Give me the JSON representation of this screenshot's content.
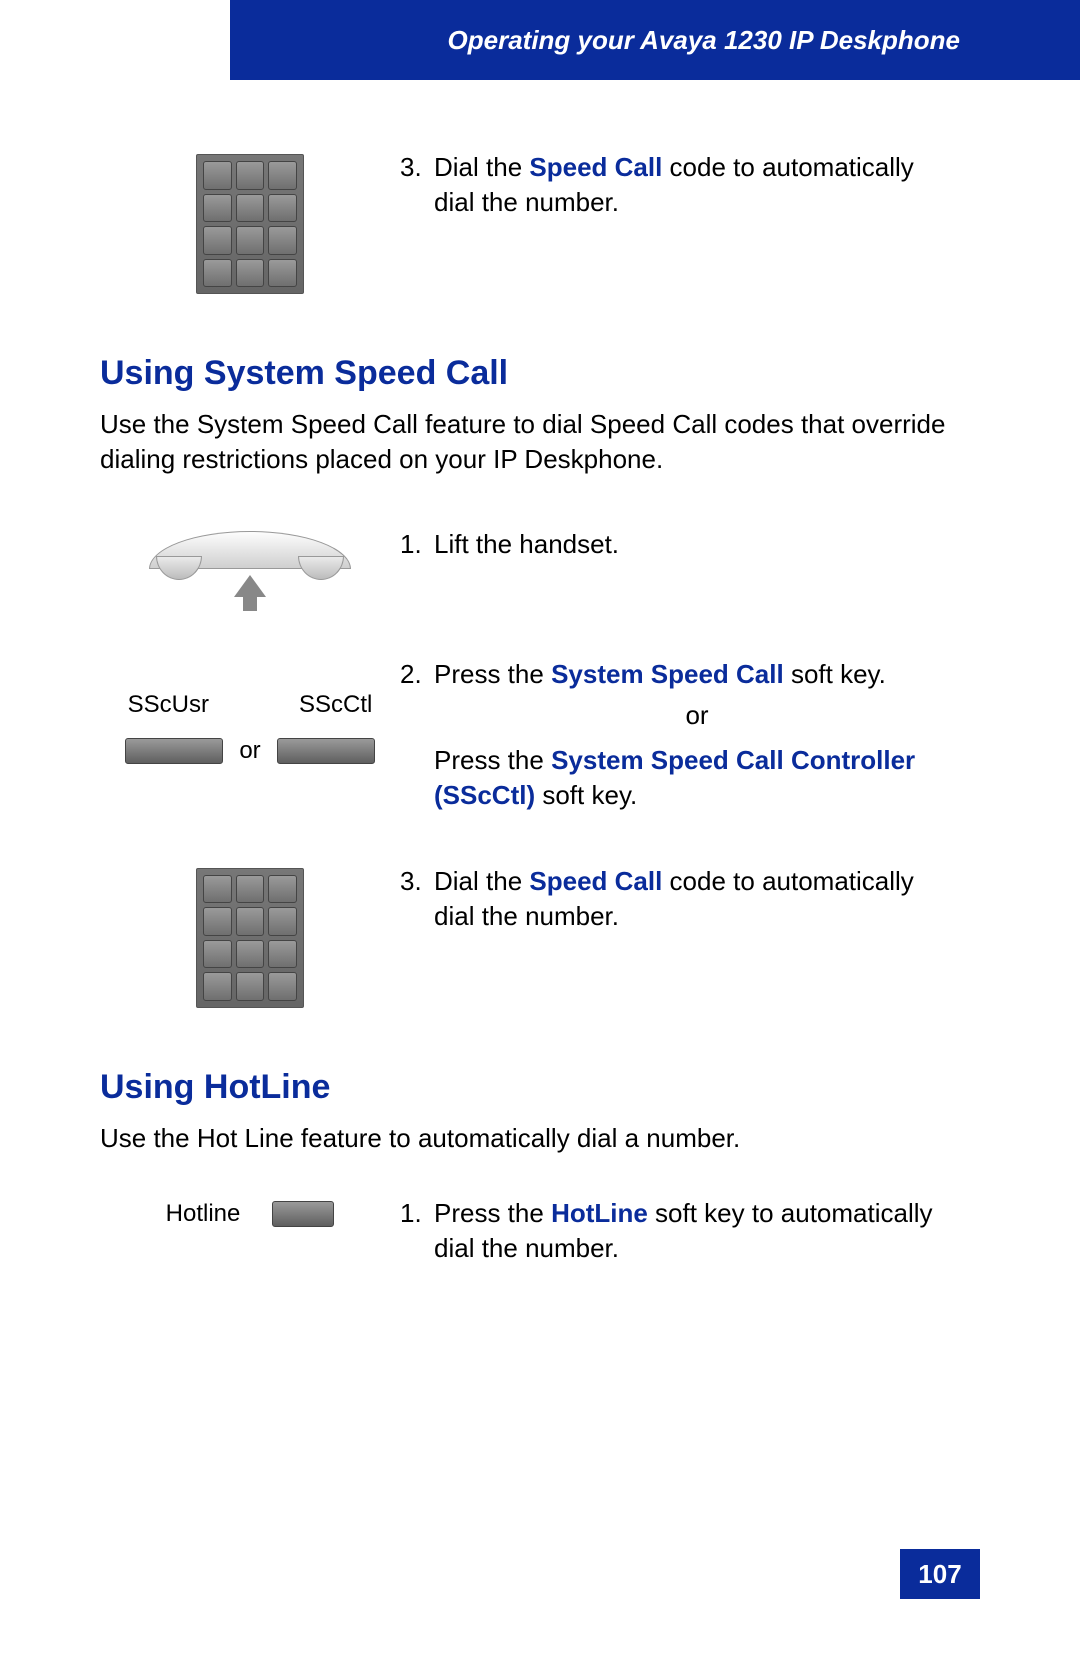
{
  "header": {
    "title": "Operating your Avaya 1230 IP Deskphone"
  },
  "section_top": {
    "step3_num": "3.",
    "step3_pre": "Dial the ",
    "step3_blue": "Speed Call",
    "step3_post": " code to automatically dial the number."
  },
  "section_syscall": {
    "heading": "Using System Speed Call",
    "intro": "Use the System Speed Call feature to dial Speed Call codes that override dialing restrictions placed on your IP Deskphone.",
    "step1_num": "1.",
    "step1_text": "Lift the handset.",
    "softkey_label1": "SScUsr",
    "softkey_label2": "SScCtl",
    "softkey_or": "or",
    "step2_num": "2.",
    "step2_pre": "Press the ",
    "step2_blue": "System Speed Call",
    "step2_post": " soft key.",
    "step2_or": "or",
    "step2b_pre": "Press the ",
    "step2b_blue": "System Speed Call Controller (SScCtl)",
    "step2b_post": " soft key.",
    "step3_num": "3.",
    "step3_pre": "Dial the ",
    "step3_blue": "Speed Call",
    "step3_post": " code to automatically dial the number."
  },
  "section_hotline": {
    "heading": "Using HotLine",
    "intro": "Use the Hot Line feature to automatically dial a number.",
    "label": "Hotline",
    "step1_num": "1.",
    "step1_pre": "Press the ",
    "step1_blue": "HotLine",
    "step1_post": " soft key to automatically dial the number."
  },
  "footer": {
    "page_num": "107"
  }
}
